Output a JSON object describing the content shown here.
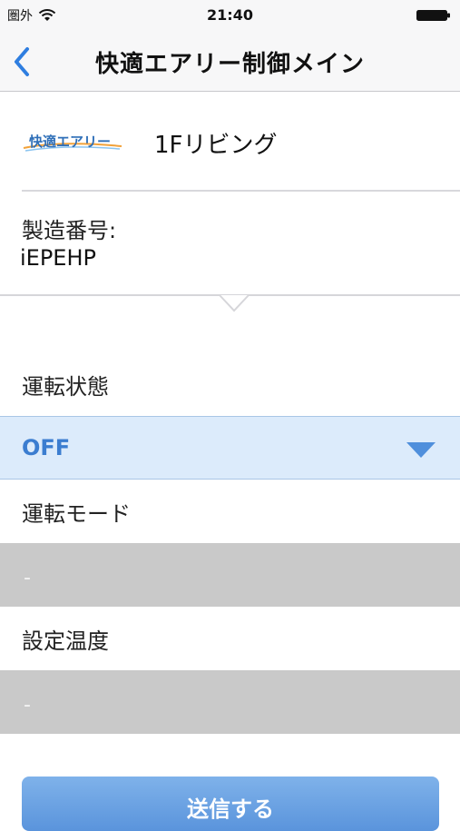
{
  "status_bar": {
    "carrier": "圏外",
    "time": "21:40"
  },
  "nav": {
    "title": "快適エアリー制御メイン"
  },
  "device": {
    "logo_text": "快適エアリー",
    "name": "1Fリビング"
  },
  "serial": {
    "label": "製造番号:",
    "value": "iEPEHP"
  },
  "operation_status": {
    "label": "運転状態",
    "value": "OFF"
  },
  "operation_mode": {
    "label": "運転モード",
    "value": "-"
  },
  "set_temperature": {
    "label": "設定温度",
    "value": "-"
  },
  "send_button": {
    "label": "送信する"
  },
  "colors": {
    "accent": "#3b7dd0",
    "selected_bg": "#dcebfb",
    "disabled_field": "#c9c9c9",
    "button": "#6aa3e4"
  }
}
